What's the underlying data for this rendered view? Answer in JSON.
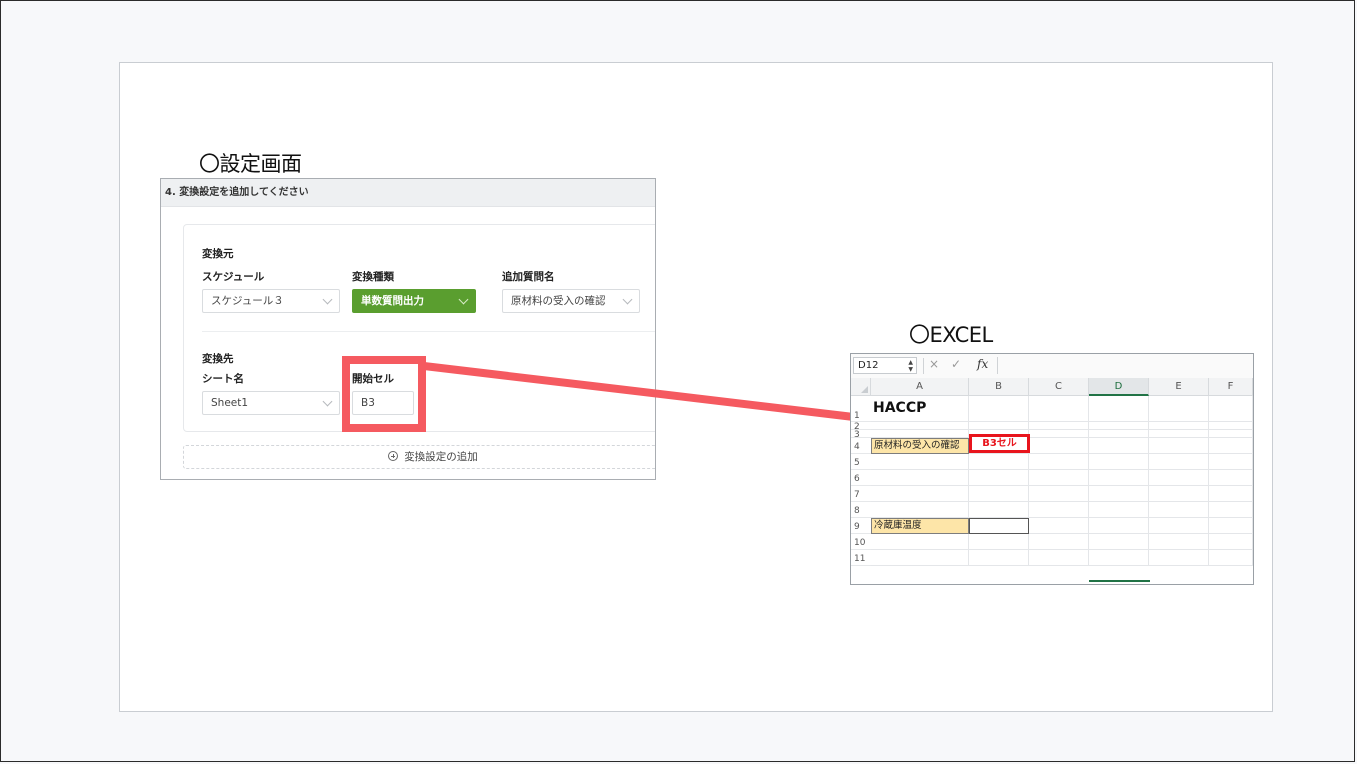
{
  "settings_heading": "〇設定画面",
  "excel_heading": "〇EXCEL",
  "panel": {
    "title": "4. 変換設定を追加してください",
    "source_section": "変換元",
    "schedule_label": "スケジュール",
    "schedule_value": "スケジュール３",
    "type_label": "変換種類",
    "type_value": "単数質問出力",
    "question_label": "追加質問名",
    "question_value": "原材料の受入の確認",
    "dest_section": "変換先",
    "sheet_label": "シート名",
    "sheet_value": "Sheet1",
    "start_cell_label": "開始セル",
    "start_cell_value": "B3",
    "add_button": "変換設定の追加"
  },
  "excel": {
    "name_box": "D12",
    "fx": "fx",
    "cancel_icon": "×",
    "confirm_icon": "✓",
    "columns": [
      "A",
      "B",
      "C",
      "D",
      "E",
      "F"
    ],
    "rows": [
      "1",
      "2",
      "3",
      "4",
      "5",
      "6",
      "7",
      "8",
      "9",
      "10",
      "11"
    ],
    "title": "HACCP",
    "a3": "原材料の受入の確認",
    "a8": "冷蔵庫温度",
    "callout": "B3セル"
  },
  "colors": {
    "accent_green": "#5a9e2f",
    "highlight_red": "#f55a60",
    "callout_red": "#e8141c",
    "cell_yellow": "#fde5a8"
  }
}
